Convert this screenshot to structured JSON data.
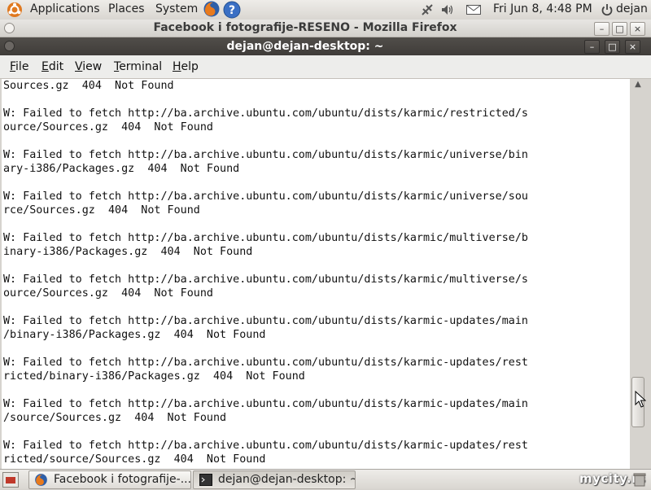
{
  "top_panel": {
    "menus": [
      "Applications",
      "Places",
      "System"
    ],
    "clock": "Fri Jun  8,  4:48 PM",
    "user": "dejan"
  },
  "firefox_window": {
    "title": "Facebook i fotografije-RESENO - Mozilla Firefox"
  },
  "terminal": {
    "title": "dejan@dejan-desktop: ~",
    "menu": {
      "file": {
        "u": "F",
        "rest": "ile"
      },
      "edit": {
        "u": "E",
        "rest": "dit"
      },
      "view": {
        "u": "V",
        "rest": "iew"
      },
      "terminal": {
        "u": "T",
        "rest": "erminal"
      },
      "help": {
        "u": "H",
        "rest": "elp"
      }
    },
    "lines": [
      "Sources.gz  404  Not Found",
      "",
      "W: Failed to fetch http://ba.archive.ubuntu.com/ubuntu/dists/karmic/restricted/s",
      "ource/Sources.gz  404  Not Found",
      "",
      "W: Failed to fetch http://ba.archive.ubuntu.com/ubuntu/dists/karmic/universe/bin",
      "ary-i386/Packages.gz  404  Not Found",
      "",
      "W: Failed to fetch http://ba.archive.ubuntu.com/ubuntu/dists/karmic/universe/sou",
      "rce/Sources.gz  404  Not Found",
      "",
      "W: Failed to fetch http://ba.archive.ubuntu.com/ubuntu/dists/karmic/multiverse/b",
      "inary-i386/Packages.gz  404  Not Found",
      "",
      "W: Failed to fetch http://ba.archive.ubuntu.com/ubuntu/dists/karmic/multiverse/s",
      "ource/Sources.gz  404  Not Found",
      "",
      "W: Failed to fetch http://ba.archive.ubuntu.com/ubuntu/dists/karmic-updates/main",
      "/binary-i386/Packages.gz  404  Not Found",
      "",
      "W: Failed to fetch http://ba.archive.ubuntu.com/ubuntu/dists/karmic-updates/rest",
      "ricted/binary-i386/Packages.gz  404  Not Found",
      "",
      "W: Failed to fetch http://ba.archive.ubuntu.com/ubuntu/dists/karmic-updates/main",
      "/source/Sources.gz  404  Not Found",
      "",
      "W: Failed to fetch http://ba.archive.ubuntu.com/ubuntu/dists/karmic-updates/rest",
      "ricted/source/Sources.gz  404  Not Found"
    ]
  },
  "taskbar": {
    "tasks": [
      "Facebook i fotografije-...",
      "dejan@dejan-desktop: ~"
    ],
    "watermark": "mycity.rs"
  }
}
